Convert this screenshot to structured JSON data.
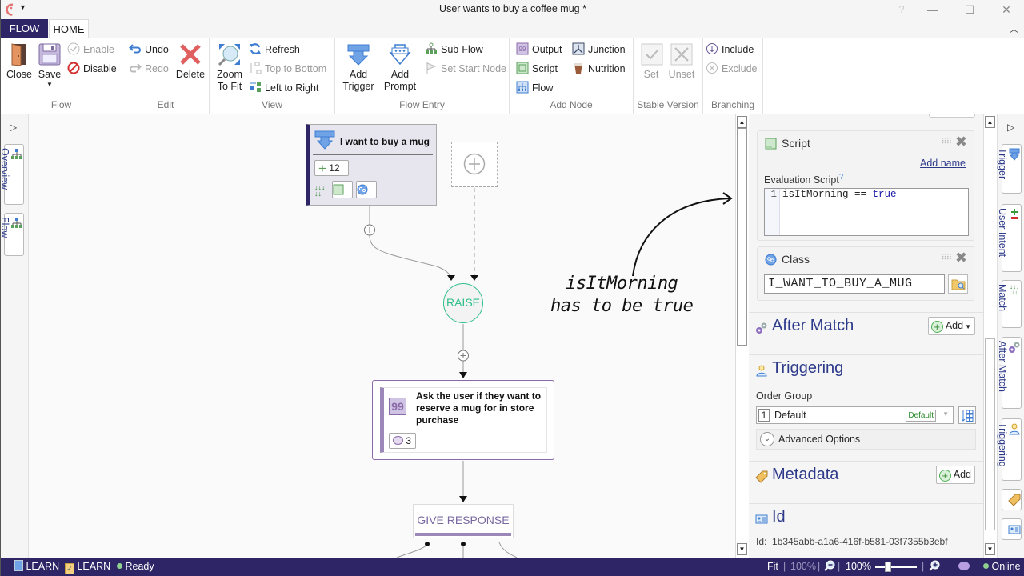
{
  "window": {
    "title": "User wants to buy a coffee mug *",
    "help_label": "?",
    "minimize_label": "—",
    "maximize_label": "☐",
    "close_label": "✕"
  },
  "tabs": [
    {
      "label": "FLOW",
      "active": false
    },
    {
      "label": "HOME",
      "active": true
    }
  ],
  "ribbon": {
    "groups": {
      "flow": {
        "label": "Flow",
        "close": "Close",
        "save": "Save",
        "enable": "Enable",
        "disable": "Disable"
      },
      "edit": {
        "label": "Edit",
        "undo": "Undo",
        "redo": "Redo",
        "delete": "Delete"
      },
      "view": {
        "label": "View",
        "zoom_to_fit_1": "Zoom",
        "zoom_to_fit_2": "To Fit",
        "refresh": "Refresh",
        "top_to_bottom": "Top to Bottom",
        "left_to_right": "Left to Right"
      },
      "flow_entry": {
        "label": "Flow Entry",
        "add_trigger_1": "Add",
        "add_trigger_2": "Trigger",
        "add_prompt_1": "Add",
        "add_prompt_2": "Prompt",
        "sub_flow": "Sub-Flow",
        "set_start_node": "Set Start Node"
      },
      "add_node": {
        "label": "Add Node",
        "output": "Output",
        "script": "Script",
        "flow": "Flow",
        "junction": "Junction",
        "nutrition": "Nutrition"
      },
      "stable_version": {
        "label": "Stable Version",
        "set": "Set",
        "unset": "Unset"
      },
      "branching": {
        "label": "Branching",
        "include": "Include",
        "exclude": "Exclude"
      }
    }
  },
  "left_strip": {
    "tabs": [
      {
        "label": "Overview"
      },
      {
        "label": "Flow"
      }
    ]
  },
  "canvas": {
    "trigger_node": {
      "title": "I want to buy a mug",
      "intent_count": "12"
    },
    "raise_node": {
      "label": "RAISE"
    },
    "prompt_node": {
      "text": "Ask the user if they want to reserve a mug for in store purchase",
      "output_count": "3"
    },
    "give_response_node": {
      "label": "GIVE RESPONSE"
    },
    "annotation": {
      "line1": "isItMorning",
      "line2": "has to be true"
    }
  },
  "right_panel": {
    "script_card": {
      "title": "Script",
      "add_name_link": "Add name",
      "eval_label": "Evaluation Script",
      "help_mark": "?",
      "line_number": "1",
      "code_ident": "isItMorning",
      "code_op": " == ",
      "code_keyword": "true"
    },
    "class_card": {
      "title": "Class",
      "value": "I_WANT_TO_BUY_A_MUG"
    },
    "after_match": {
      "title": "After Match",
      "add_label": "Add"
    },
    "triggering": {
      "title": "Triggering",
      "order_group_label": "Order Group",
      "order_group_number": "1",
      "order_group_value": "Default",
      "order_group_badge": "Default",
      "advanced_options": "Advanced Options"
    },
    "metadata": {
      "title": "Metadata",
      "add_label": "Add"
    },
    "id_section": {
      "title": "Id",
      "label": "Id:",
      "value": "1b345abb-a1a6-416f-b581-03f7355b3ebf"
    }
  },
  "right_strip": {
    "tabs": [
      {
        "label": "Trigger"
      },
      {
        "label": "User Intent"
      },
      {
        "label": "Match"
      },
      {
        "label": "After Match"
      },
      {
        "label": "Triggering"
      }
    ]
  },
  "statusbar": {
    "learn1": "LEARN",
    "learn2": "LEARN",
    "status": "Ready",
    "fit": "Fit",
    "zoom_fit_value": "100%",
    "zoom_value": "100%",
    "zoom_slider_percent": 28,
    "connection": "Online"
  },
  "colors": {
    "brand_dark": "#2e2566",
    "accent_green": "#2fbf8a",
    "prompt_purple": "#9c88b8",
    "link_blue": "#2d3a8a"
  }
}
